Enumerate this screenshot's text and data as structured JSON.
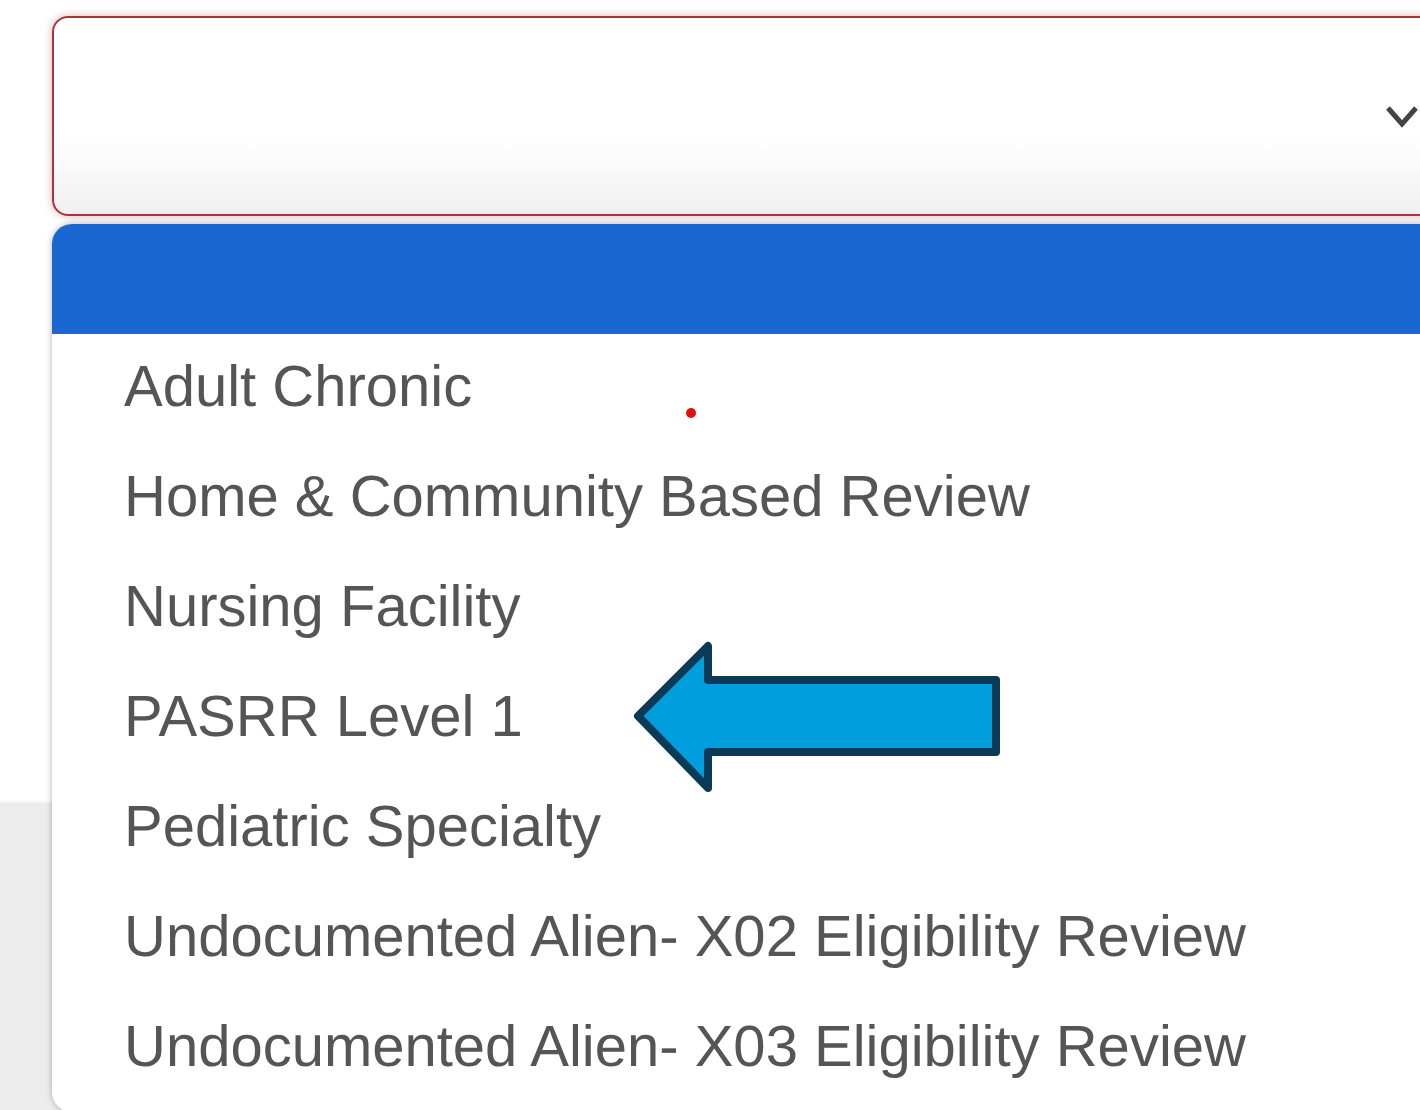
{
  "select": {
    "invalid": true,
    "expanded": true
  },
  "options": [
    {
      "selected": true
    },
    {
      "label": "Adult Chronic",
      "selected": false
    },
    {
      "label": "Home & Community Based Review",
      "selected": false
    },
    {
      "label": "Nursing Facility",
      "selected": false
    },
    {
      "label": "PASRR Level 1",
      "selected": false
    },
    {
      "label": "Pediatric Specialty",
      "selected": false
    },
    {
      "label": "Undocumented Alien- X02 Eligibility Review",
      "selected": false
    },
    {
      "label": "Undocumented Alien- X03 Eligibility Review",
      "selected": false
    }
  ]
}
